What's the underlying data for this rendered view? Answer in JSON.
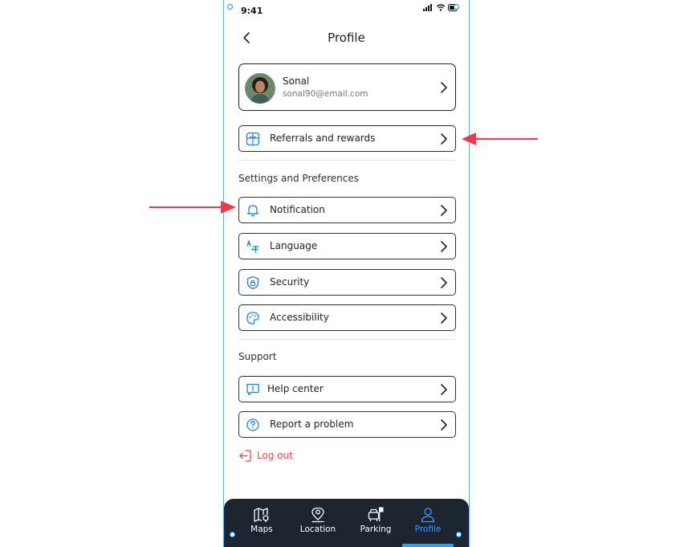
{
  "status_bar": {
    "time": "9:41"
  },
  "header": {
    "title": "Profile"
  },
  "profile": {
    "name": "Sonal",
    "email": "sonal90@email.com"
  },
  "referrals": {
    "label": "Referrals and rewards"
  },
  "settings_section": {
    "title": "Settings and Preferences",
    "items": [
      {
        "label": "Notification",
        "icon": "bell-icon"
      },
      {
        "label": "Language",
        "icon": "translate-icon"
      },
      {
        "label": "Security",
        "icon": "shield-icon"
      },
      {
        "label": "Accessibility",
        "icon": "palette-icon"
      }
    ]
  },
  "support_section": {
    "title": "Support",
    "items": [
      {
        "label": "Help center",
        "icon": "help-chat-icon"
      },
      {
        "label": "Report a problem",
        "icon": "question-circle-icon"
      }
    ]
  },
  "logout": {
    "label": "Log out"
  },
  "bottom_nav": {
    "items": [
      {
        "label": "Maps",
        "icon": "map-icon"
      },
      {
        "label": "Location",
        "icon": "location-pin-icon"
      },
      {
        "label": "Parking",
        "icon": "parking-icon"
      },
      {
        "label": "Profile",
        "icon": "user-icon"
      }
    ],
    "active": "Profile"
  },
  "colors": {
    "accent": "#3a9bff",
    "danger": "#e8424c",
    "nav_background": "#1c2430",
    "annotation_arrow": "#ee3b48"
  }
}
